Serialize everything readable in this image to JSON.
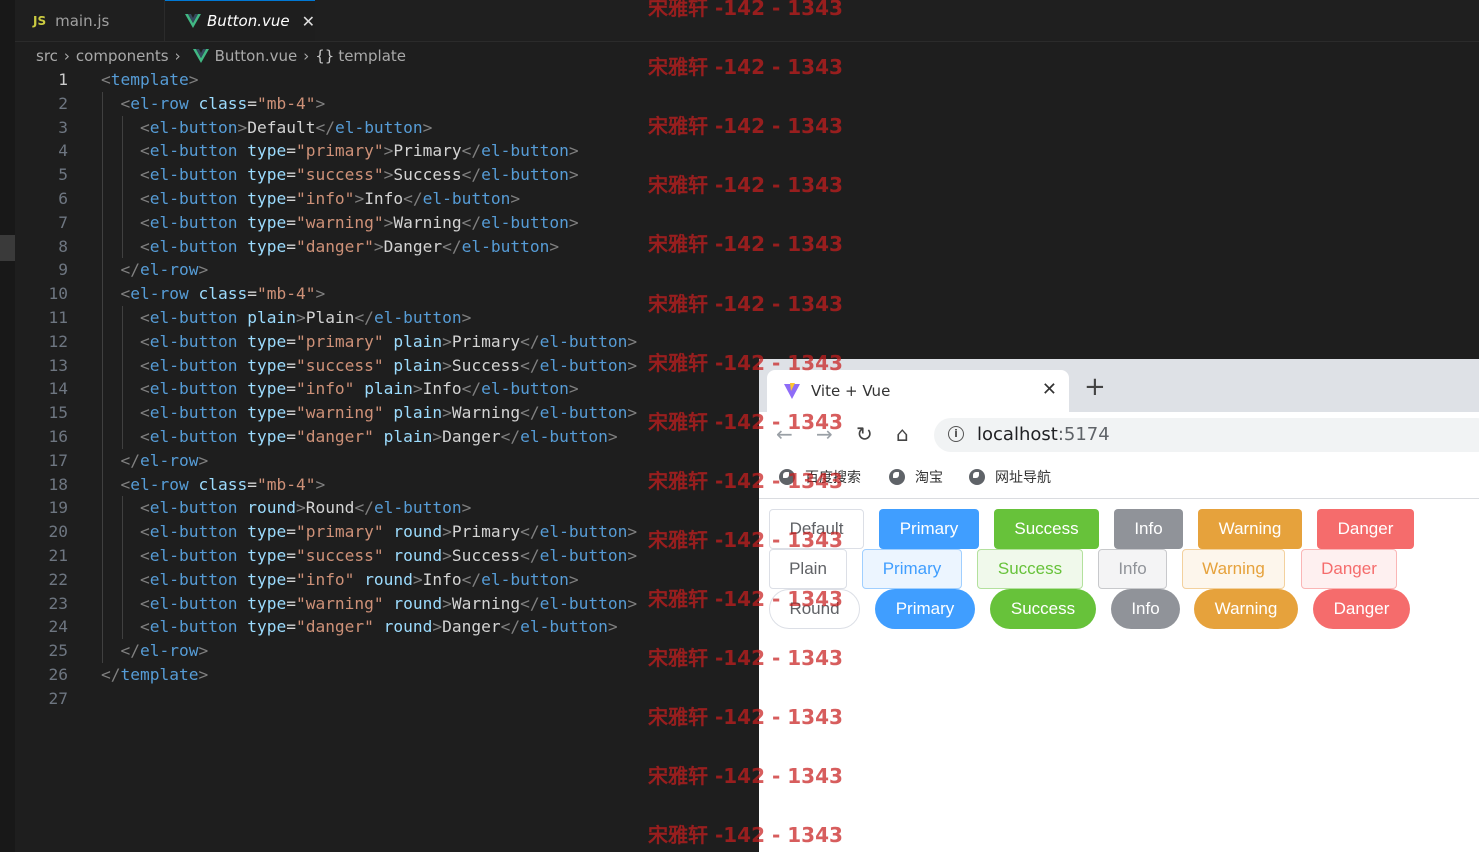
{
  "editor": {
    "tabs": [
      {
        "icon": "JS",
        "label": "main.js"
      },
      {
        "label": "Button.vue",
        "close": "✕"
      }
    ],
    "breadcrumb": [
      "src",
      "components",
      "Button.vue",
      "template"
    ],
    "breadcrumb_symbol": "{}",
    "active_line": 1
  },
  "code_lines": [
    {
      "n": "1",
      "indent": 0,
      "tokens": [
        [
          "p",
          "<"
        ],
        [
          "t",
          "template"
        ],
        [
          "p",
          ">"
        ]
      ]
    },
    {
      "n": "2",
      "indent": 1,
      "tokens": [
        [
          "p",
          "<"
        ],
        [
          "t",
          "el-row"
        ],
        [
          "x",
          " "
        ],
        [
          "a",
          "class"
        ],
        [
          "x",
          "="
        ],
        [
          "v",
          "\"mb-4\""
        ],
        [
          "p",
          ">"
        ]
      ]
    },
    {
      "n": "3",
      "indent": 2,
      "tokens": [
        [
          "p",
          "<"
        ],
        [
          "t",
          "el-button"
        ],
        [
          "p",
          ">"
        ],
        [
          "x",
          "Default"
        ],
        [
          "p",
          "</"
        ],
        [
          "t",
          "el-button"
        ],
        [
          "p",
          ">"
        ]
      ]
    },
    {
      "n": "4",
      "indent": 2,
      "tokens": [
        [
          "p",
          "<"
        ],
        [
          "t",
          "el-button"
        ],
        [
          "x",
          " "
        ],
        [
          "a",
          "type"
        ],
        [
          "x",
          "="
        ],
        [
          "v",
          "\"primary\""
        ],
        [
          "p",
          ">"
        ],
        [
          "x",
          "Primary"
        ],
        [
          "p",
          "</"
        ],
        [
          "t",
          "el-button"
        ],
        [
          "p",
          ">"
        ]
      ]
    },
    {
      "n": "5",
      "indent": 2,
      "tokens": [
        [
          "p",
          "<"
        ],
        [
          "t",
          "el-button"
        ],
        [
          "x",
          " "
        ],
        [
          "a",
          "type"
        ],
        [
          "x",
          "="
        ],
        [
          "v",
          "\"success\""
        ],
        [
          "p",
          ">"
        ],
        [
          "x",
          "Success"
        ],
        [
          "p",
          "</"
        ],
        [
          "t",
          "el-button"
        ],
        [
          "p",
          ">"
        ]
      ]
    },
    {
      "n": "6",
      "indent": 2,
      "tokens": [
        [
          "p",
          "<"
        ],
        [
          "t",
          "el-button"
        ],
        [
          "x",
          " "
        ],
        [
          "a",
          "type"
        ],
        [
          "x",
          "="
        ],
        [
          "v",
          "\"info\""
        ],
        [
          "p",
          ">"
        ],
        [
          "x",
          "Info"
        ],
        [
          "p",
          "</"
        ],
        [
          "t",
          "el-button"
        ],
        [
          "p",
          ">"
        ]
      ]
    },
    {
      "n": "7",
      "indent": 2,
      "tokens": [
        [
          "p",
          "<"
        ],
        [
          "t",
          "el-button"
        ],
        [
          "x",
          " "
        ],
        [
          "a",
          "type"
        ],
        [
          "x",
          "="
        ],
        [
          "v",
          "\"warning\""
        ],
        [
          "p",
          ">"
        ],
        [
          "x",
          "Warning"
        ],
        [
          "p",
          "</"
        ],
        [
          "t",
          "el-button"
        ],
        [
          "p",
          ">"
        ]
      ]
    },
    {
      "n": "8",
      "indent": 2,
      "tokens": [
        [
          "p",
          "<"
        ],
        [
          "t",
          "el-button"
        ],
        [
          "x",
          " "
        ],
        [
          "a",
          "type"
        ],
        [
          "x",
          "="
        ],
        [
          "v",
          "\"danger\""
        ],
        [
          "p",
          ">"
        ],
        [
          "x",
          "Danger"
        ],
        [
          "p",
          "</"
        ],
        [
          "t",
          "el-button"
        ],
        [
          "p",
          ">"
        ]
      ]
    },
    {
      "n": "9",
      "indent": 1,
      "tokens": [
        [
          "p",
          "</"
        ],
        [
          "t",
          "el-row"
        ],
        [
          "p",
          ">"
        ]
      ]
    },
    {
      "n": "10",
      "indent": 1,
      "tokens": [
        [
          "p",
          "<"
        ],
        [
          "t",
          "el-row"
        ],
        [
          "x",
          " "
        ],
        [
          "a",
          "class"
        ],
        [
          "x",
          "="
        ],
        [
          "v",
          "\"mb-4\""
        ],
        [
          "p",
          ">"
        ]
      ]
    },
    {
      "n": "11",
      "indent": 2,
      "tokens": [
        [
          "p",
          "<"
        ],
        [
          "t",
          "el-button"
        ],
        [
          "x",
          " "
        ],
        [
          "a",
          "plain"
        ],
        [
          "p",
          ">"
        ],
        [
          "x",
          "Plain"
        ],
        [
          "p",
          "</"
        ],
        [
          "t",
          "el-button"
        ],
        [
          "p",
          ">"
        ]
      ]
    },
    {
      "n": "12",
      "indent": 2,
      "tokens": [
        [
          "p",
          "<"
        ],
        [
          "t",
          "el-button"
        ],
        [
          "x",
          " "
        ],
        [
          "a",
          "type"
        ],
        [
          "x",
          "="
        ],
        [
          "v",
          "\"primary\""
        ],
        [
          "x",
          " "
        ],
        [
          "a",
          "plain"
        ],
        [
          "p",
          ">"
        ],
        [
          "x",
          "Primary"
        ],
        [
          "p",
          "</"
        ],
        [
          "t",
          "el-button"
        ],
        [
          "p",
          ">"
        ]
      ]
    },
    {
      "n": "13",
      "indent": 2,
      "tokens": [
        [
          "p",
          "<"
        ],
        [
          "t",
          "el-button"
        ],
        [
          "x",
          " "
        ],
        [
          "a",
          "type"
        ],
        [
          "x",
          "="
        ],
        [
          "v",
          "\"success\""
        ],
        [
          "x",
          " "
        ],
        [
          "a",
          "plain"
        ],
        [
          "p",
          ">"
        ],
        [
          "x",
          "Success"
        ],
        [
          "p",
          "</"
        ],
        [
          "t",
          "el-button"
        ],
        [
          "p",
          ">"
        ]
      ]
    },
    {
      "n": "14",
      "indent": 2,
      "tokens": [
        [
          "p",
          "<"
        ],
        [
          "t",
          "el-button"
        ],
        [
          "x",
          " "
        ],
        [
          "a",
          "type"
        ],
        [
          "x",
          "="
        ],
        [
          "v",
          "\"info\""
        ],
        [
          "x",
          " "
        ],
        [
          "a",
          "plain"
        ],
        [
          "p",
          ">"
        ],
        [
          "x",
          "Info"
        ],
        [
          "p",
          "</"
        ],
        [
          "t",
          "el-button"
        ],
        [
          "p",
          ">"
        ]
      ]
    },
    {
      "n": "15",
      "indent": 2,
      "tokens": [
        [
          "p",
          "<"
        ],
        [
          "t",
          "el-button"
        ],
        [
          "x",
          " "
        ],
        [
          "a",
          "type"
        ],
        [
          "x",
          "="
        ],
        [
          "v",
          "\"warning\""
        ],
        [
          "x",
          " "
        ],
        [
          "a",
          "plain"
        ],
        [
          "p",
          ">"
        ],
        [
          "x",
          "Warning"
        ],
        [
          "p",
          "</"
        ],
        [
          "t",
          "el-button"
        ],
        [
          "p",
          ">"
        ]
      ]
    },
    {
      "n": "16",
      "indent": 2,
      "tokens": [
        [
          "p",
          "<"
        ],
        [
          "t",
          "el-button"
        ],
        [
          "x",
          " "
        ],
        [
          "a",
          "type"
        ],
        [
          "x",
          "="
        ],
        [
          "v",
          "\"danger\""
        ],
        [
          "x",
          " "
        ],
        [
          "a",
          "plain"
        ],
        [
          "p",
          ">"
        ],
        [
          "x",
          "Danger"
        ],
        [
          "p",
          "</"
        ],
        [
          "t",
          "el-button"
        ],
        [
          "p",
          ">"
        ]
      ]
    },
    {
      "n": "17",
      "indent": 1,
      "tokens": [
        [
          "p",
          "</"
        ],
        [
          "t",
          "el-row"
        ],
        [
          "p",
          ">"
        ]
      ]
    },
    {
      "n": "18",
      "indent": 1,
      "tokens": [
        [
          "p",
          "<"
        ],
        [
          "t",
          "el-row"
        ],
        [
          "x",
          " "
        ],
        [
          "a",
          "class"
        ],
        [
          "x",
          "="
        ],
        [
          "v",
          "\"mb-4\""
        ],
        [
          "p",
          ">"
        ]
      ]
    },
    {
      "n": "19",
      "indent": 2,
      "tokens": [
        [
          "p",
          "<"
        ],
        [
          "t",
          "el-button"
        ],
        [
          "x",
          " "
        ],
        [
          "a",
          "round"
        ],
        [
          "p",
          ">"
        ],
        [
          "x",
          "Round"
        ],
        [
          "p",
          "</"
        ],
        [
          "t",
          "el-button"
        ],
        [
          "p",
          ">"
        ]
      ]
    },
    {
      "n": "20",
      "indent": 2,
      "tokens": [
        [
          "p",
          "<"
        ],
        [
          "t",
          "el-button"
        ],
        [
          "x",
          " "
        ],
        [
          "a",
          "type"
        ],
        [
          "x",
          "="
        ],
        [
          "v",
          "\"primary\""
        ],
        [
          "x",
          " "
        ],
        [
          "a",
          "round"
        ],
        [
          "p",
          ">"
        ],
        [
          "x",
          "Primary"
        ],
        [
          "p",
          "</"
        ],
        [
          "t",
          "el-button"
        ],
        [
          "p",
          ">"
        ]
      ]
    },
    {
      "n": "21",
      "indent": 2,
      "tokens": [
        [
          "p",
          "<"
        ],
        [
          "t",
          "el-button"
        ],
        [
          "x",
          " "
        ],
        [
          "a",
          "type"
        ],
        [
          "x",
          "="
        ],
        [
          "v",
          "\"success\""
        ],
        [
          "x",
          " "
        ],
        [
          "a",
          "round"
        ],
        [
          "p",
          ">"
        ],
        [
          "x",
          "Success"
        ],
        [
          "p",
          "</"
        ],
        [
          "t",
          "el-button"
        ],
        [
          "p",
          ">"
        ]
      ]
    },
    {
      "n": "22",
      "indent": 2,
      "tokens": [
        [
          "p",
          "<"
        ],
        [
          "t",
          "el-button"
        ],
        [
          "x",
          " "
        ],
        [
          "a",
          "type"
        ],
        [
          "x",
          "="
        ],
        [
          "v",
          "\"info\""
        ],
        [
          "x",
          " "
        ],
        [
          "a",
          "round"
        ],
        [
          "p",
          ">"
        ],
        [
          "x",
          "Info"
        ],
        [
          "p",
          "</"
        ],
        [
          "t",
          "el-button"
        ],
        [
          "p",
          ">"
        ]
      ]
    },
    {
      "n": "23",
      "indent": 2,
      "tokens": [
        [
          "p",
          "<"
        ],
        [
          "t",
          "el-button"
        ],
        [
          "x",
          " "
        ],
        [
          "a",
          "type"
        ],
        [
          "x",
          "="
        ],
        [
          "v",
          "\"warning\""
        ],
        [
          "x",
          " "
        ],
        [
          "a",
          "round"
        ],
        [
          "p",
          ">"
        ],
        [
          "x",
          "Warning"
        ],
        [
          "p",
          "</"
        ],
        [
          "t",
          "el-button"
        ],
        [
          "p",
          ">"
        ]
      ]
    },
    {
      "n": "24",
      "indent": 2,
      "tokens": [
        [
          "p",
          "<"
        ],
        [
          "t",
          "el-button"
        ],
        [
          "x",
          " "
        ],
        [
          "a",
          "type"
        ],
        [
          "x",
          "="
        ],
        [
          "v",
          "\"danger\""
        ],
        [
          "x",
          " "
        ],
        [
          "a",
          "round"
        ],
        [
          "p",
          ">"
        ],
        [
          "x",
          "Danger"
        ],
        [
          "p",
          "</"
        ],
        [
          "t",
          "el-button"
        ],
        [
          "p",
          ">"
        ]
      ]
    },
    {
      "n": "25",
      "indent": 1,
      "tokens": [
        [
          "p",
          "</"
        ],
        [
          "t",
          "el-row"
        ],
        [
          "p",
          ">"
        ]
      ]
    },
    {
      "n": "26",
      "indent": 0,
      "tokens": [
        [
          "p",
          "</"
        ],
        [
          "t",
          "template"
        ],
        [
          "p",
          ">"
        ]
      ]
    },
    {
      "n": "27",
      "indent": 0,
      "tokens": []
    }
  ],
  "watermark": "宋雅轩 -142 - 1343",
  "browser": {
    "tab_title": "Vite + Vue",
    "tab_close": "✕",
    "new_tab": "+",
    "nav": {
      "back": "←",
      "forward": "→",
      "reload": "↻",
      "home": "⌂"
    },
    "url_host": "localhost",
    "url_port": ":5174",
    "bookmarks": [
      "百度搜索",
      "淘宝",
      "网址导航"
    ]
  },
  "buttons": {
    "row1": [
      "Default",
      "Primary",
      "Success",
      "Info",
      "Warning",
      "Danger"
    ],
    "row2": [
      "Plain",
      "Primary",
      "Success",
      "Info",
      "Warning",
      "Danger"
    ],
    "row3": [
      "Round",
      "Primary",
      "Success",
      "Info",
      "Warning",
      "Danger"
    ]
  },
  "colors": {
    "primary": "#409eff",
    "success": "#67c23a",
    "info": "#909399",
    "warning": "#e6a23c",
    "danger": "#f56c6c",
    "editor_bg": "#1e1e1e",
    "tag": "#569cd6",
    "attr": "#9cdcfe",
    "string": "#ce9178"
  }
}
